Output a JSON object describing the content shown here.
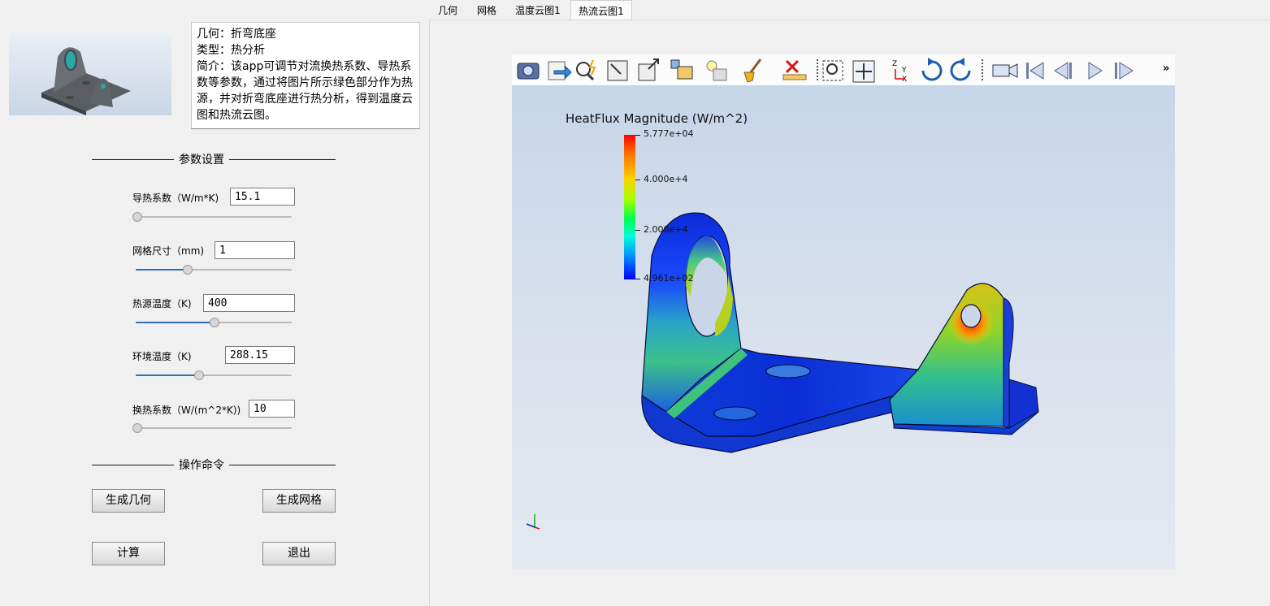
{
  "tabs": [
    {
      "label": "几何",
      "active": false
    },
    {
      "label": "网格",
      "active": false
    },
    {
      "label": "温度云图1",
      "active": false
    },
    {
      "label": "热流云图1",
      "active": true
    }
  ],
  "description": {
    "line1": "几何：折弯底座",
    "line2": "类型：热分析",
    "line3": "简介：该app可调节对流换热系数、导热系数等参数，通过将图片所示绿色部分作为热源，并对折弯底座进行热分析，得到温度云图和热流云图。"
  },
  "sections": {
    "params_title": "参数设置",
    "commands_title": "操作命令"
  },
  "params": [
    {
      "label": "导热系数（W/m*K)",
      "value": "15.1",
      "slider": 0.0
    },
    {
      "label": "网格尺寸（mm)",
      "value": "1",
      "slider": 0.33
    },
    {
      "label": "热源温度（K)",
      "value": "400",
      "slider": 0.5
    },
    {
      "label": "环境温度（K)",
      "value": "288.15",
      "slider": 0.4
    },
    {
      "label": "换热系数（W/(m^2*K))",
      "value": "10",
      "slider": 0.0
    }
  ],
  "buttons": {
    "gen_geometry": "生成几何",
    "gen_mesh": "生成网格",
    "compute": "计算",
    "exit": "退出"
  },
  "toolbar": {
    "icons": [
      "camera-icon",
      "export-icon",
      "zoom-spark-icon",
      "zoom-fit-icon",
      "zoom-box-icon",
      "view-cube-icon",
      "light-icon",
      "brush-icon",
      "clear-icon",
      "zoom-region-icon",
      "pan-icon",
      "axes-icon",
      "rotate-cw-icon",
      "rotate-ccw-icon",
      "video-icon",
      "first-frame-icon",
      "prev-frame-icon",
      "play-icon",
      "next-frame-icon"
    ],
    "overflow": "»"
  },
  "legend": {
    "title": "HeatFlux Magnitude (W/m^2)",
    "max": "5.777e+04",
    "mid1": "4.000e+4",
    "mid2": "2.000e+4",
    "min": "4.961e+02"
  },
  "colors": {
    "accent": "#2f6db5",
    "viewer_top": "#c4d4e8",
    "viewer_bottom": "#e4e9f1"
  }
}
